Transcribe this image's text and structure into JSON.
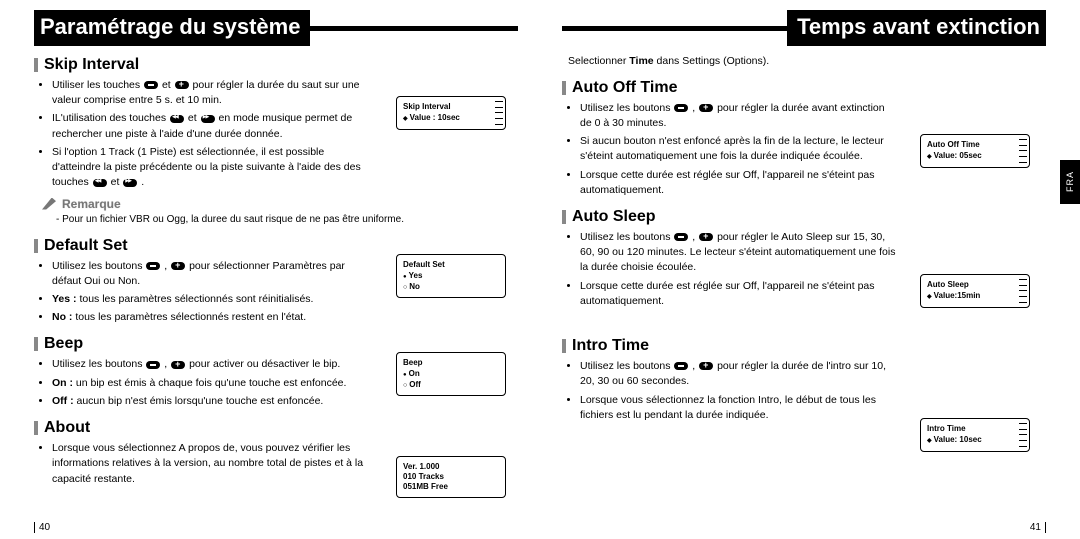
{
  "left": {
    "header": "Paramétrage du système",
    "page_num": "40",
    "skip_interval": {
      "title": "Skip Interval",
      "b1a": "Utiliser les touches ",
      "b1b": " et ",
      "b1c": " pour régler la durée du saut sur une valeur comprise entre 5 s. et 10 min.",
      "b2a": "IL'utilisation des touches ",
      "b2b": " et ",
      "b2c": " en mode musique permet de rechercher une piste à l'aide d'une durée donnée.",
      "b3a": "Si l'option 1 Track (1 Piste) est sélectionnée, il est possible d'atteindre la piste précédente ou la piste suivante à l'aide des des touches ",
      "b3b": " et ",
      "b3c": " .",
      "note_title": "Remarque",
      "note_body": "Pour un fichier VBR ou Ogg, la duree du saut risque de ne pas être uniforme.",
      "lcd": {
        "title": "Skip Interval",
        "value": "Value : 10sec"
      }
    },
    "default_set": {
      "title": "Default Set",
      "b1a": "Utilisez les boutons ",
      "b1b": " , ",
      "b1c": " pour sélectionner Paramètres par défaut Oui ou Non.",
      "b2_strong": "Yes :",
      "b2_rest": " tous les paramètres sélectionnés sont réinitialisés.",
      "b3_strong": "No :",
      "b3_rest": " tous les paramètres sélectionnés restent en l'état.",
      "lcd": {
        "title": "Default Set",
        "opt1": "Yes",
        "opt2": "No"
      }
    },
    "beep": {
      "title": "Beep",
      "b1a": "Utilisez les boutons ",
      "b1b": " , ",
      "b1c": " pour activer ou désactiver le bip.",
      "b2_strong": "On :",
      "b2_rest": " un bip est émis à chaque fois qu'une touche est enfoncée.",
      "b3_strong": "Off :",
      "b3_rest": " aucun bip n'est émis lorsqu'une touche est enfoncée.",
      "lcd": {
        "title": "Beep",
        "opt1": "On",
        "opt2": "Off"
      }
    },
    "about": {
      "title": "About",
      "b1": "Lorsque vous sélectionnez A propos de, vous pouvez vérifier les informations relatives à la version, au nombre total de pistes et à la capacité restante.",
      "lcd": {
        "l1": "Ver.  1.000",
        "l2": "010 Tracks",
        "l3": "051MB Free"
      }
    }
  },
  "right": {
    "header": "Temps avant extinction",
    "page_num": "41",
    "side_tab": "FRA",
    "intro_a": "Selectionner ",
    "intro_strong": "Time",
    "intro_b": " dans Settings (Options).",
    "auto_off": {
      "title": "Auto Off Time",
      "b1a": "Utilisez les boutons ",
      "b1b": " , ",
      "b1c": " pour régler la durée avant extinction de 0 à 30 minutes.",
      "b2": "Si aucun bouton n'est enfoncé après la fin de la lecture, le lecteur s'éteint automatiquement une fois la durée indiquée écoulée.",
      "b3": "Lorsque cette durée est réglée sur Off, l'appareil ne s'éteint pas automatiquement.",
      "lcd": {
        "title": "Auto Off Time",
        "value": "Value: 05sec"
      }
    },
    "auto_sleep": {
      "title": "Auto Sleep",
      "b1a": "Utilisez les boutons ",
      "b1b": " , ",
      "b1c": " pour régler le Auto Sleep sur 15, 30, 60, 90 ou 120 minutes. Le lecteur s'éteint automatiquement une fois la durée choisie écoulée.",
      "b2": "Lorsque cette durée est réglée sur Off, l'appareil ne s'éteint pas automatiquement.",
      "lcd": {
        "title": "Auto Sleep",
        "value": "Value:15min"
      }
    },
    "intro_time": {
      "title": "Intro Time",
      "b1a": "Utilisez les boutons ",
      "b1b": " , ",
      "b1c": " pour régler la durée de l'intro sur 10, 20, 30 ou 60 secondes.",
      "b2": "Lorsque vous sélectionnez la fonction Intro, le début de tous les fichiers est lu pendant la durée indiquée.",
      "lcd": {
        "title": "Intro Time",
        "value": "Value: 10sec"
      }
    }
  }
}
